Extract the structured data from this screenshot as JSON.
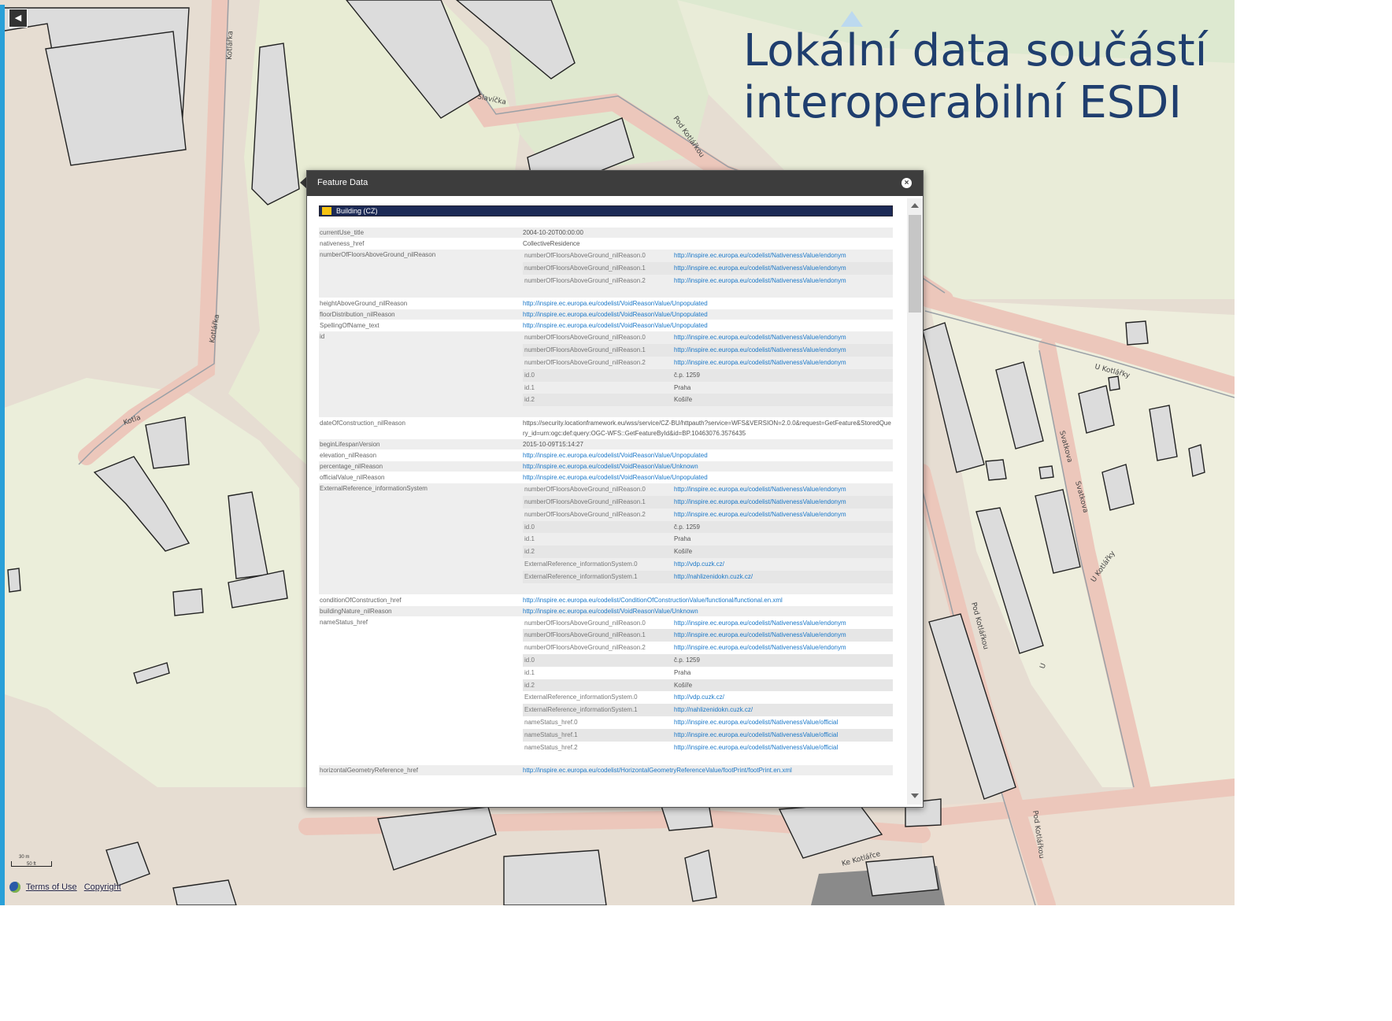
{
  "slide": {
    "title_line1": "Lokální data součástí",
    "title_line2": "interoperabilní ESDI"
  },
  "map": {
    "streets": [
      "Kotlářka",
      "Kotlářka",
      "Kotla",
      "Slavíčka",
      "Pod Kotlářkou",
      "U Kotlářky",
      "Svatkova",
      "Svatkova",
      "U Kotlářky",
      "Pod Kotlářkou",
      "Pod Kotlářkou",
      "Ke Kotlářce",
      "U"
    ],
    "scale_top": "30 m",
    "scale_bottom": "50 ft",
    "attribution": {
      "terms": "Terms of Use",
      "copyright": "Copyright"
    },
    "colors": {
      "residential": "#e4d9cc",
      "park": "#e8ecd4",
      "road_pink": "#ecc9bd",
      "building": "#dcdcdc",
      "building_stroke": "#222222",
      "strip": "#2aa0d8"
    }
  },
  "popup": {
    "title": "Feature Data",
    "close_icon": "close-circle-icon",
    "layer_name": "Building (CZ)",
    "rows": [
      {
        "key": "currentUse_title",
        "value": "2004-10-20T00:00:00"
      },
      {
        "key": "nativeness_href",
        "value": "CollectiveResidence"
      },
      {
        "key": "numberOfFloorsAboveGround_nilReason",
        "sub": [
          {
            "key": "numberOfFloorsAboveGround_nilReason.0",
            "value": "http://inspire.ec.europa.eu/codelist/NativenessValue/endonym",
            "link": true
          },
          {
            "key": "numberOfFloorsAboveGround_nilReason.1",
            "value": "http://inspire.ec.europa.eu/codelist/NativenessValue/endonym",
            "link": true
          },
          {
            "key": "numberOfFloorsAboveGround_nilReason.2",
            "value": "http://inspire.ec.europa.eu/codelist/NativenessValue/endonym",
            "link": true
          }
        ]
      },
      {
        "key": "heightAboveGround_nilReason",
        "value": "http://inspire.ec.europa.eu/codelist/VoidReasonValue/Unpopulated",
        "link": true
      },
      {
        "key": "floorDistribution_nilReason",
        "value": "http://inspire.ec.europa.eu/codelist/VoidReasonValue/Unpopulated",
        "link": true
      },
      {
        "key": "SpellingOfName_text",
        "value": "http://inspire.ec.europa.eu/codelist/VoidReasonValue/Unpopulated",
        "link": true
      },
      {
        "key": "id",
        "sub": [
          {
            "key": "numberOfFloorsAboveGround_nilReason.0",
            "value": "http://inspire.ec.europa.eu/codelist/NativenessValue/endonym",
            "link": true
          },
          {
            "key": "numberOfFloorsAboveGround_nilReason.1",
            "value": "http://inspire.ec.europa.eu/codelist/NativenessValue/endonym",
            "link": true
          },
          {
            "key": "numberOfFloorsAboveGround_nilReason.2",
            "value": "http://inspire.ec.europa.eu/codelist/NativenessValue/endonym",
            "link": true
          },
          {
            "key": "id.0",
            "value": "č.p. 1259"
          },
          {
            "key": "id.1",
            "value": "Praha"
          },
          {
            "key": "id.2",
            "value": "Košíře"
          }
        ]
      },
      {
        "key": "dateOfConstruction_nilReason",
        "value": "https://security.locationframework.eu/wss/service/CZ-BU/httpauth?service=WFS&VERSION=2.0.0&request=GetFeature&StoredQuery_id=urn:ogc:def:query:OGC-WFS::GetFeatureById&id=BP.10463076.3576435"
      },
      {
        "key": "beginLifespanVersion",
        "value": "2015-10-09T15:14:27"
      },
      {
        "key": "elevation_nilReason",
        "value": "http://inspire.ec.europa.eu/codelist/VoidReasonValue/Unpopulated",
        "link": true
      },
      {
        "key": "percentage_nilReason",
        "value": "http://inspire.ec.europa.eu/codelist/VoidReasonValue/Unknown",
        "link": true
      },
      {
        "key": "officialValue_nilReason",
        "value": "http://inspire.ec.europa.eu/codelist/VoidReasonValue/Unpopulated",
        "link": true
      },
      {
        "key": "ExternalReference_informationSystem",
        "sub": [
          {
            "key": "numberOfFloorsAboveGround_nilReason.0",
            "value": "http://inspire.ec.europa.eu/codelist/NativenessValue/endonym",
            "link": true
          },
          {
            "key": "numberOfFloorsAboveGround_nilReason.1",
            "value": "http://inspire.ec.europa.eu/codelist/NativenessValue/endonym",
            "link": true
          },
          {
            "key": "numberOfFloorsAboveGround_nilReason.2",
            "value": "http://inspire.ec.europa.eu/codelist/NativenessValue/endonym",
            "link": true
          },
          {
            "key": "id.0",
            "value": "č.p. 1259"
          },
          {
            "key": "id.1",
            "value": "Praha"
          },
          {
            "key": "id.2",
            "value": "Košíře"
          },
          {
            "key": "ExternalReference_informationSystem.0",
            "value": "http://vdp.cuzk.cz/",
            "link": true
          },
          {
            "key": "ExternalReference_informationSystem.1",
            "value": "http://nahlizenidokn.cuzk.cz/",
            "link": true
          }
        ]
      },
      {
        "key": "conditionOfConstruction_href",
        "value": "http://inspire.ec.europa.eu/codelist/ConditionOfConstructionValue/functional/functional.en.xml",
        "link": true
      },
      {
        "key": "buildingNature_nilReason",
        "value": "http://inspire.ec.europa.eu/codelist/VoidReasonValue/Unknown",
        "link": true
      },
      {
        "key": "nameStatus_href",
        "sub": [
          {
            "key": "numberOfFloorsAboveGround_nilReason.0",
            "value": "http://inspire.ec.europa.eu/codelist/NativenessValue/endonym",
            "link": true
          },
          {
            "key": "numberOfFloorsAboveGround_nilReason.1",
            "value": "http://inspire.ec.europa.eu/codelist/NativenessValue/endonym",
            "link": true
          },
          {
            "key": "numberOfFloorsAboveGround_nilReason.2",
            "value": "http://inspire.ec.europa.eu/codelist/NativenessValue/endonym",
            "link": true
          },
          {
            "key": "id.0",
            "value": "č.p. 1259"
          },
          {
            "key": "id.1",
            "value": "Praha"
          },
          {
            "key": "id.2",
            "value": "Košíře"
          },
          {
            "key": "ExternalReference_informationSystem.0",
            "value": "http://vdp.cuzk.cz/",
            "link": true
          },
          {
            "key": "ExternalReference_informationSystem.1",
            "value": "http://nahlizenidokn.cuzk.cz/",
            "link": true
          },
          {
            "key": "nameStatus_href.0",
            "value": "http://inspire.ec.europa.eu/codelist/NativenessValue/official",
            "link": true
          },
          {
            "key": "nameStatus_href.1",
            "value": "http://inspire.ec.europa.eu/codelist/NativenessValue/official",
            "link": true
          },
          {
            "key": "nameStatus_href.2",
            "value": "http://inspire.ec.europa.eu/codelist/NativenessValue/official",
            "link": true
          }
        ]
      },
      {
        "key": "horizontalGeometryReference_href",
        "value": "http://inspire.ec.europa.eu/codelist/HorizontalGeometryReferenceValue/footPrint/footPrint.en.xml",
        "link": true
      }
    ]
  }
}
